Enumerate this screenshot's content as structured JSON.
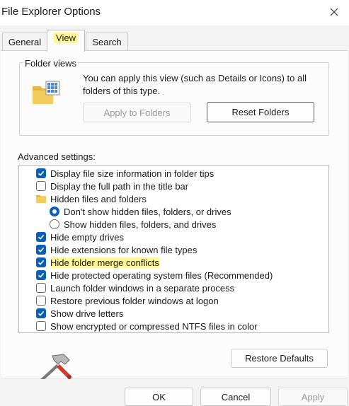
{
  "window": {
    "title": "File Explorer Options"
  },
  "tabs": [
    {
      "label": "General",
      "active": false
    },
    {
      "label": "View",
      "active": true
    },
    {
      "label": "Search",
      "active": false
    }
  ],
  "folder_views": {
    "group_label": "Folder views",
    "description": "You can apply this view (such as Details or Icons) to all folders of this type.",
    "apply_label": "Apply to Folders",
    "reset_label": "Reset Folders"
  },
  "advanced": {
    "label": "Advanced settings:",
    "items": [
      {
        "kind": "checkbox",
        "checked": true,
        "label": "Display file size information in folder tips",
        "highlight": false
      },
      {
        "kind": "checkbox",
        "checked": false,
        "label": "Display the full path in the title bar",
        "highlight": false
      },
      {
        "kind": "folder",
        "label": "Hidden files and folders",
        "highlight": false
      },
      {
        "kind": "radio",
        "checked": true,
        "label": "Don't show hidden files, folders, or drives",
        "highlight": false
      },
      {
        "kind": "radio",
        "checked": false,
        "label": "Show hidden files, folders, and drives",
        "highlight": false
      },
      {
        "kind": "checkbox",
        "checked": true,
        "label": "Hide empty drives",
        "highlight": false
      },
      {
        "kind": "checkbox",
        "checked": true,
        "label": "Hide extensions for known file types",
        "highlight": false
      },
      {
        "kind": "checkbox",
        "checked": true,
        "label": "Hide folder merge conflicts",
        "highlight": true
      },
      {
        "kind": "checkbox",
        "checked": true,
        "label": "Hide protected operating system files (Recommended)",
        "highlight": false
      },
      {
        "kind": "checkbox",
        "checked": false,
        "label": "Launch folder windows in a separate process",
        "highlight": false
      },
      {
        "kind": "checkbox",
        "checked": false,
        "label": "Restore previous folder windows at logon",
        "highlight": false
      },
      {
        "kind": "checkbox",
        "checked": true,
        "label": "Show drive letters",
        "highlight": false
      },
      {
        "kind": "checkbox",
        "checked": false,
        "label": "Show encrypted or compressed NTFS files in color",
        "highlight": false
      }
    ]
  },
  "restore_defaults_label": "Restore Defaults",
  "footer": {
    "ok_label": "OK",
    "cancel_label": "Cancel",
    "apply_label": "Apply"
  },
  "colors": {
    "accent": "#0a5eb8",
    "highlight": "#fff59a"
  }
}
